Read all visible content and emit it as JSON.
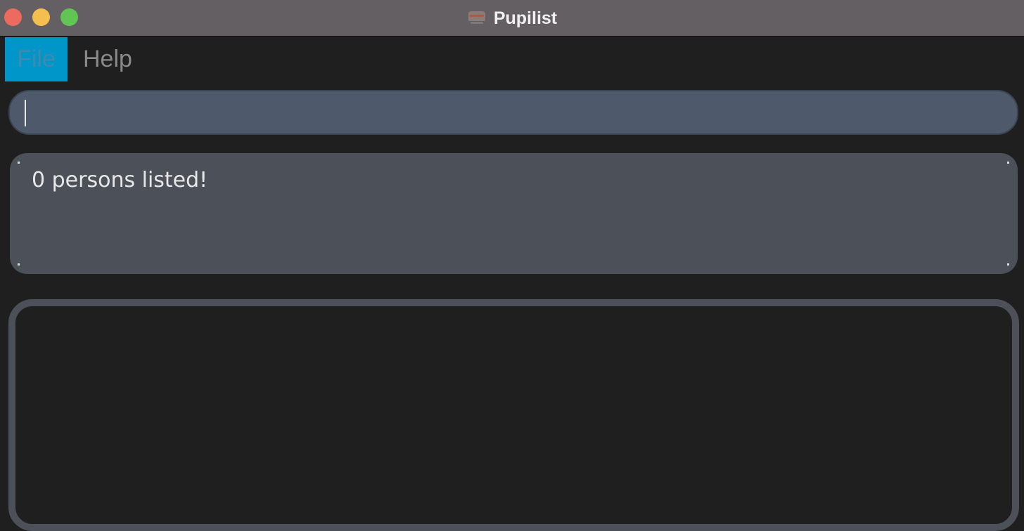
{
  "window": {
    "title": "Pupilist"
  },
  "menu": {
    "items": [
      {
        "label": "File",
        "selected": true
      },
      {
        "label": "Help",
        "selected": false
      }
    ]
  },
  "command": {
    "value": "",
    "placeholder": ""
  },
  "result": {
    "message": "0 persons listed!"
  },
  "colors": {
    "titlebar": "#635f63",
    "background": "#1f1f1f",
    "menu_selected": "#0096c9",
    "command_box": "#4e5a6b",
    "result_box": "#4c5159"
  }
}
